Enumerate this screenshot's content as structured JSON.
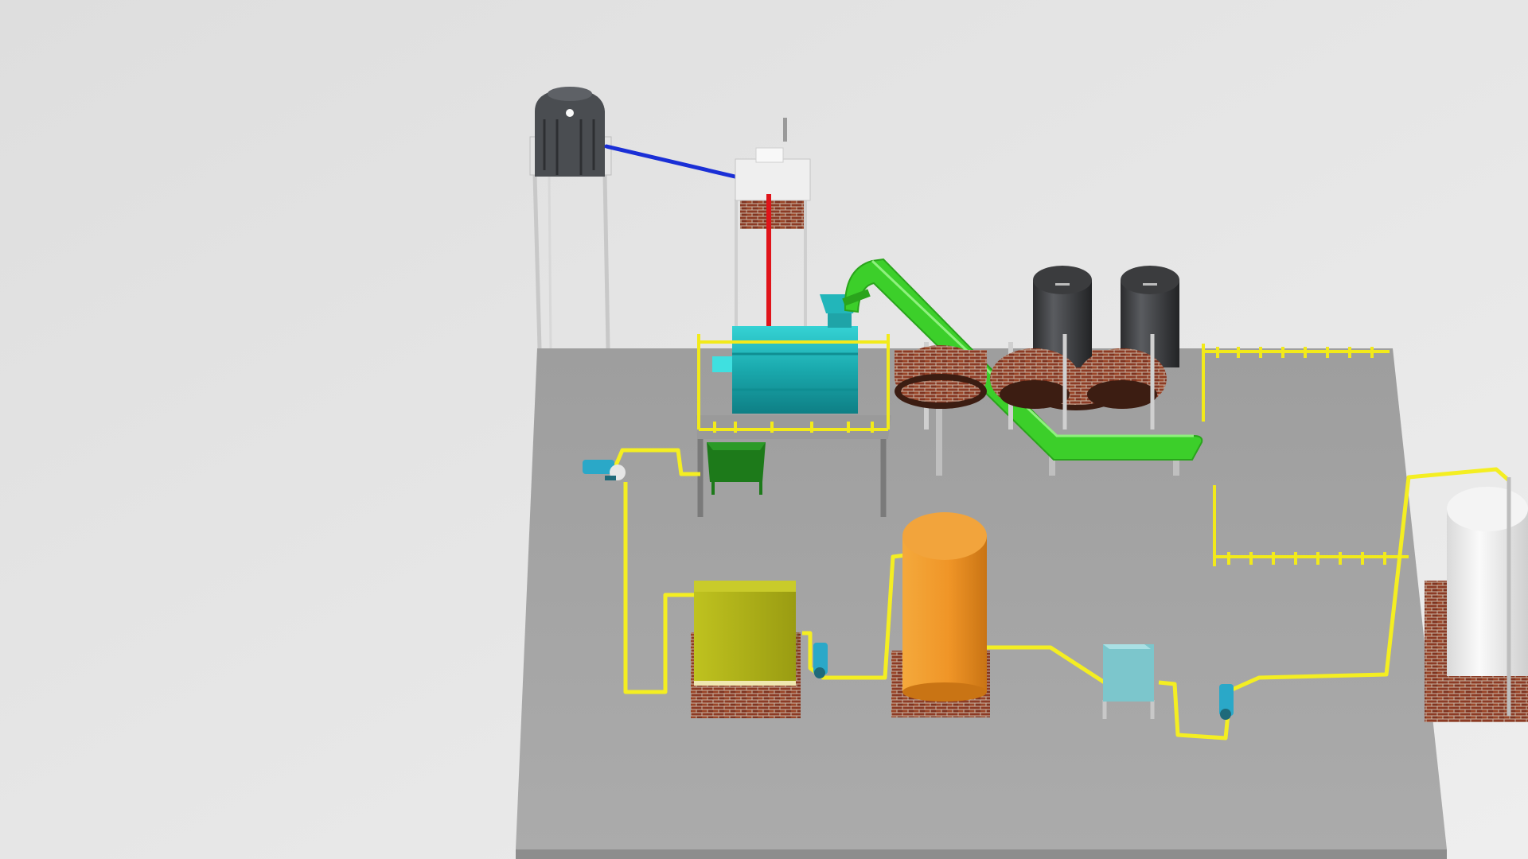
{
  "scene": {
    "colors": {
      "background": "#e4e4e4",
      "floor": "#a4a4a4",
      "steel": "#c8c8c8",
      "brick": "#8c3a24",
      "mortar": "#c9b7a6",
      "railing": "#f2ea1a",
      "pipe_yellow": "#f4ee22",
      "pipe_blue": "#1a2fd6",
      "pipe_red": "#e0141a",
      "conveyor_green": "#3ccf2a",
      "drum_teal": "#1fb4b8",
      "hopper_green": "#1d7a1a",
      "tank_olive": "#b2b41a",
      "tank_orange": "#f19a2a",
      "tank_white": "#f1f1f1",
      "filter_cyan": "#7cc6cc",
      "silo_dark": "#3a3b3d",
      "vessel_dark": "#4b4e52",
      "pump_cyan": "#2aa8c8"
    },
    "icons": [
      "pressure-vessel-icon",
      "burner-box-icon",
      "rotary-drum-icon",
      "conveyor-icon",
      "silo-icon",
      "pump-icon",
      "storage-tank-icon",
      "filter-box-icon"
    ]
  }
}
